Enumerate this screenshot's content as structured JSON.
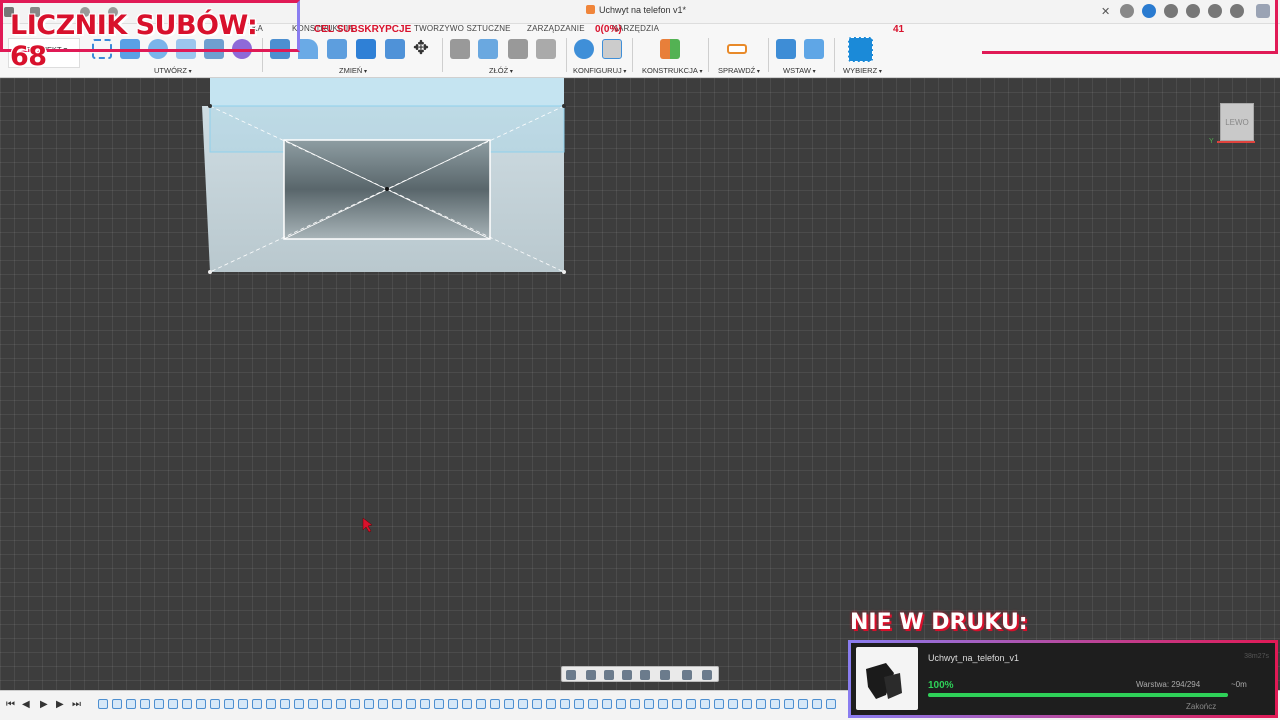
{
  "window": {
    "title": "Uchwyt na telefon v1*"
  },
  "ribbon": {
    "project_button": "PROJEKT",
    "tabs": [
      "KONSTRUKCJA",
      "TWORZYWO SZTUCZNE",
      "ZARZĄDZANIE",
      "NARZĘDZIA"
    ],
    "tab_left": "KA",
    "groups": [
      "UTWÓRZ",
      "ZMIEŃ",
      "ZŁÓŻ",
      "KONFIGURUJ",
      "KONSTRUKCJA",
      "SPRAWDŹ",
      "WSTAW",
      "WYBIERZ"
    ]
  },
  "viewcube": {
    "face_label": "LEWO"
  },
  "overlay": {
    "sub_counter": "LICZNIK SUBÓW: 68",
    "goal_label": "CEL SUBSKRYPCJE",
    "goal_progress": "0(0%)",
    "goal_target": "41"
  },
  "print_status": {
    "heading": "NIE W DRUKU:",
    "file_name": "Uchwyt_na_telefon_v1",
    "elapsed": "38m27s",
    "percent_value": 1.0,
    "percent_label": "100%",
    "layer": "Warstwa: 294/294",
    "remaining": "~0m",
    "finish_label": "Zakończ"
  },
  "colors": {
    "accent_red": "#d8112c",
    "accent_pink": "#e01a56",
    "accent_violet": "#8a7df0",
    "progress_green": "#2ed158",
    "selection_blue": "#6fb7dd"
  }
}
